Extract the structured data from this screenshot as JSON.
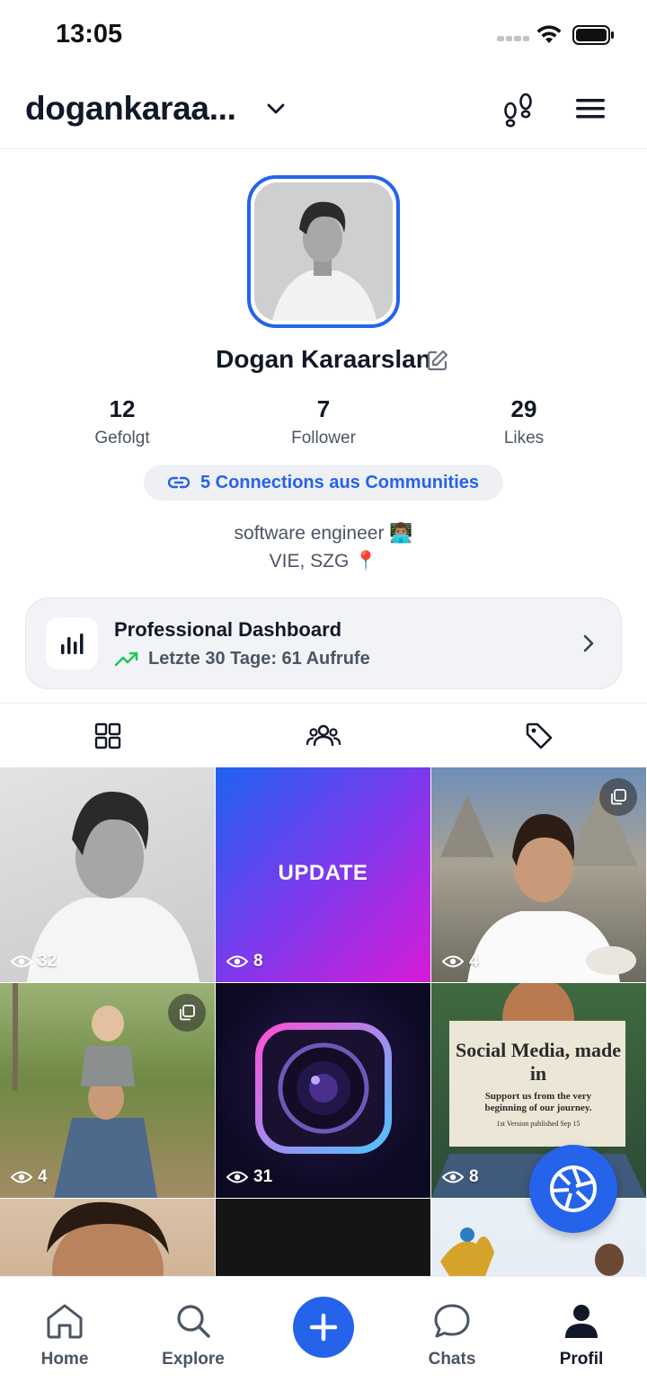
{
  "status_bar": {
    "time": "13:05"
  },
  "header": {
    "username": "dogankaraa..."
  },
  "profile": {
    "name": "Dogan Karaarslan",
    "stats": [
      {
        "value": "12",
        "label": "Gefolgt"
      },
      {
        "value": "7",
        "label": "Follower"
      },
      {
        "value": "29",
        "label": "Likes"
      }
    ],
    "connections_label": "5 Connections aus Communities",
    "bio_line1": "software engineer 👨🏽‍💻",
    "bio_line2": "VIE, SZG 📍"
  },
  "dashboard": {
    "title": "Professional Dashboard",
    "subtitle": "Letzte 30 Tage: 61 Aufrufe"
  },
  "grid": {
    "posts": [
      {
        "views": "32"
      },
      {
        "views": "8",
        "overlay_text": "UPDATE"
      },
      {
        "views": "4"
      },
      {
        "views": "4"
      },
      {
        "views": "31"
      },
      {
        "views": "8",
        "newspaper_headline": "Social Media, made in",
        "newspaper_sub": "Support us from the very beginning of our journey.",
        "newspaper_small": "1st Version published Sep 15"
      }
    ]
  },
  "bottom_nav": {
    "items": [
      {
        "label": "Home"
      },
      {
        "label": "Explore"
      },
      {
        "label": "Chats"
      },
      {
        "label": "Profil"
      }
    ]
  },
  "colors": {
    "accent": "#2563eb",
    "text": "#111827",
    "muted": "#4b5563",
    "positive": "#22c55e"
  }
}
